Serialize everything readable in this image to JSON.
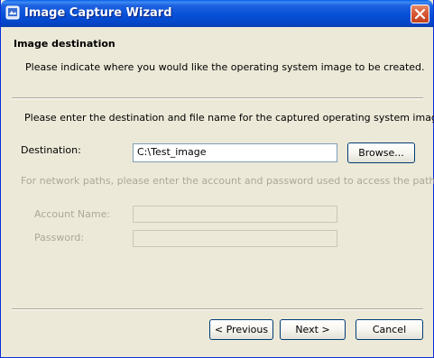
{
  "window": {
    "title": "Image Capture Wizard",
    "close_icon": "close-icon",
    "app_icon": "wizard-app-icon"
  },
  "header": {
    "title": "Image destination",
    "description": "Please indicate where you would like the operating system image to be created."
  },
  "body": {
    "instruction": "Please enter the destination and file name for the captured operating system image.",
    "destination_label": "Destination:",
    "destination_value": "C:\\Test_image",
    "browse_label": "Browse...",
    "network_note": "For network paths, please enter the account and password used to access the path.",
    "account_label": "Account Name:",
    "account_value": "",
    "password_label": "Password:",
    "password_value": ""
  },
  "footer": {
    "previous_label": "< Previous",
    "next_label": "Next >",
    "cancel_label": "Cancel"
  }
}
